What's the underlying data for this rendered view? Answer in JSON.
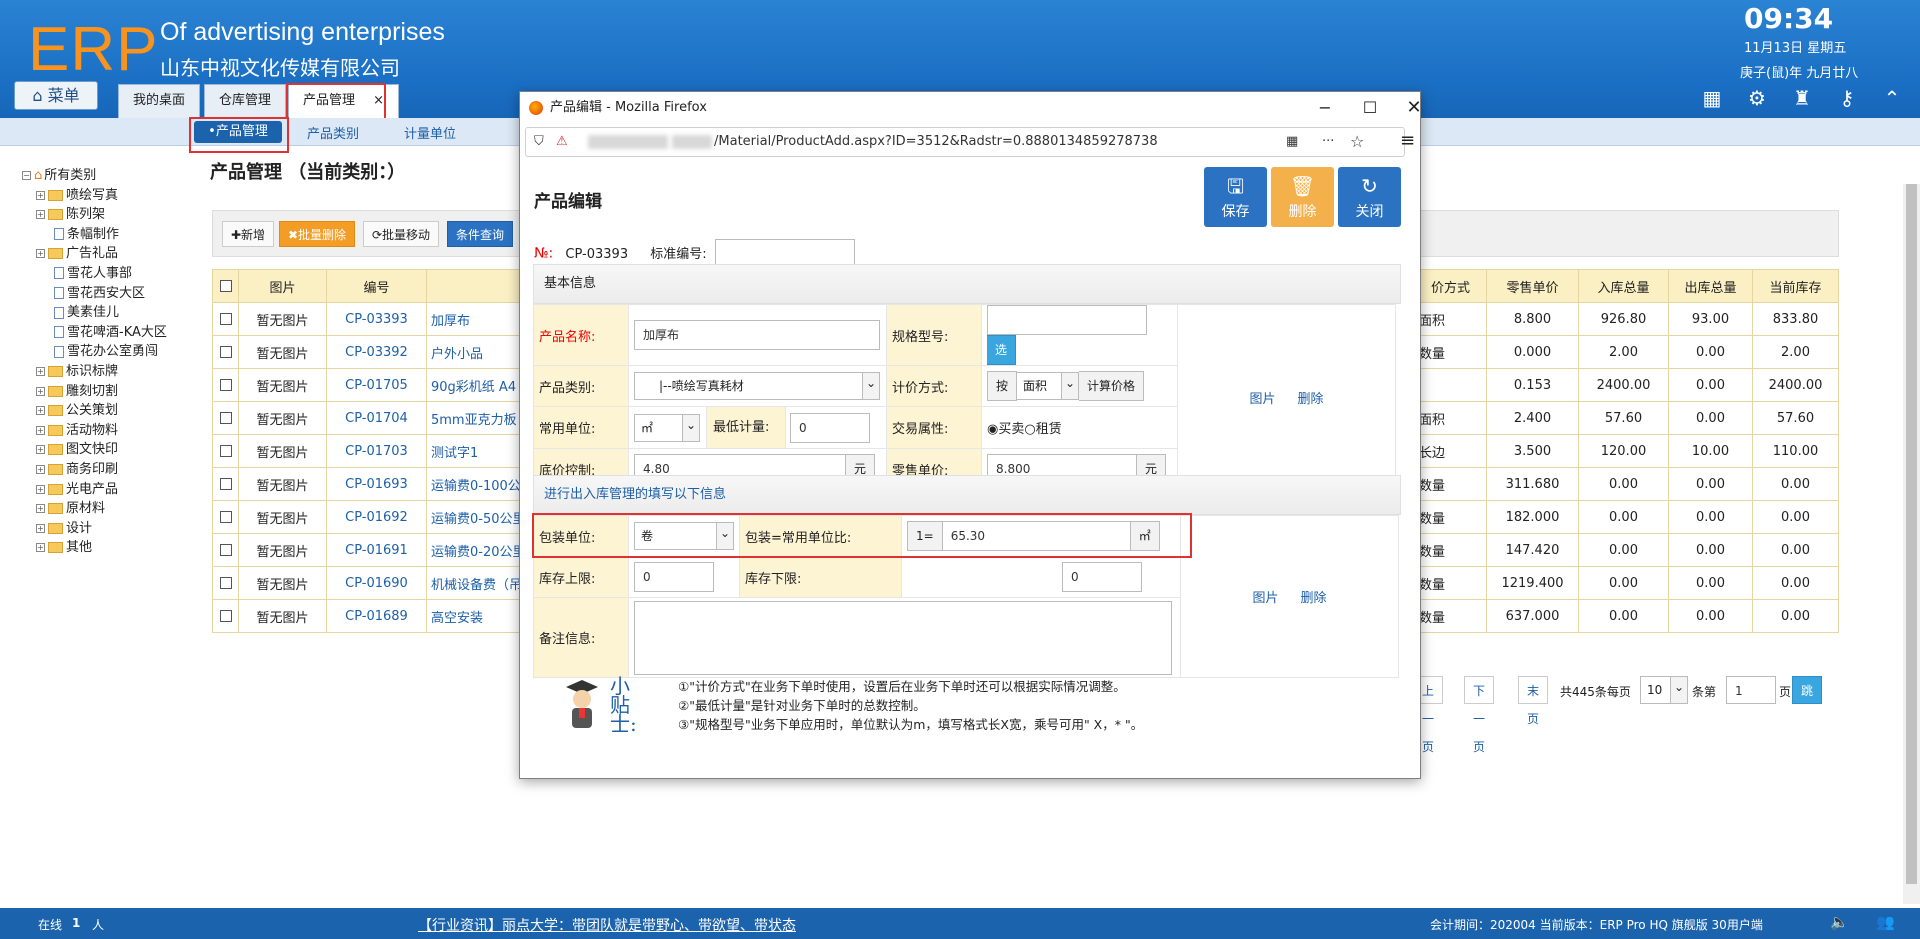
{
  "header": {
    "logo": "ERP",
    "brand_en": "Of advertising enterprises",
    "brand_cn": "山东中视文化传媒有限公司",
    "time": "09:34",
    "date": "11月13日 星期五",
    "lunar": "庚子(鼠)年 九月廿八",
    "menu_label": "菜单"
  },
  "tabs": [
    {
      "label": "我的桌面"
    },
    {
      "label": "仓库管理"
    },
    {
      "label": "产品管理",
      "close": "×"
    }
  ],
  "subnav": {
    "items": [
      "•产品管理",
      "产品类别",
      "计量单位"
    ]
  },
  "tree": {
    "root": "所有类别",
    "items": [
      {
        "label": "喷绘写真",
        "type": "folder"
      },
      {
        "label": "陈列架",
        "type": "folder"
      },
      {
        "label": "条幅制作",
        "type": "doc"
      },
      {
        "label": "广告礼品",
        "type": "folder"
      },
      {
        "label": "雪花人事部",
        "type": "doc"
      },
      {
        "label": "雪花西安大区",
        "type": "doc"
      },
      {
        "label": "美素佳儿",
        "type": "doc"
      },
      {
        "label": "雪花啤酒-KA大区",
        "type": "doc"
      },
      {
        "label": "雪花办公室勇闯",
        "type": "doc"
      },
      {
        "label": "标识标牌",
        "type": "folder"
      },
      {
        "label": "雕刻切割",
        "type": "folder"
      },
      {
        "label": "公关策划",
        "type": "folder"
      },
      {
        "label": "活动物料",
        "type": "folder"
      },
      {
        "label": "图文快印",
        "type": "folder"
      },
      {
        "label": "商务印刷",
        "type": "folder"
      },
      {
        "label": "光电产品",
        "type": "folder"
      },
      {
        "label": "原材料",
        "type": "folder"
      },
      {
        "label": "设计",
        "type": "folder"
      },
      {
        "label": "其他",
        "type": "folder"
      }
    ]
  },
  "page": {
    "title": "产品管理 （当前类别：）"
  },
  "toolbar": {
    "add": "✚新增",
    "batch_delete": "✖批量删除",
    "batch_move": "⟳批量移动",
    "query": "条件查询"
  },
  "grid": {
    "headers": [
      "图片",
      "编号",
      ""
    ],
    "right_headers": [
      "价方式",
      "零售单价",
      "入库总量",
      "出库总量",
      "当前库存"
    ],
    "rows": [
      {
        "img": "暂无图片",
        "code": "CP-03393",
        "name": "加厚布",
        "r": [
          "面积",
          "8.800",
          "926.80",
          "93.00",
          "833.80"
        ]
      },
      {
        "img": "暂无图片",
        "code": "CP-03392",
        "name": "户外小品",
        "r": [
          "数量",
          "0.000",
          "2.00",
          "0.00",
          "2.00"
        ]
      },
      {
        "img": "暂无图片",
        "code": "CP-01705",
        "name": "90g彩机纸 A4",
        "r": [
          "",
          "0.153",
          "2400.00",
          "0.00",
          "2400.00"
        ]
      },
      {
        "img": "暂无图片",
        "code": "CP-01704",
        "name": "5mm亚克力板",
        "r": [
          "面积",
          "2.400",
          "57.60",
          "0.00",
          "57.60"
        ]
      },
      {
        "img": "暂无图片",
        "code": "CP-01703",
        "name": "测试字1",
        "r": [
          "长边",
          "3.500",
          "120.00",
          "10.00",
          "110.00"
        ]
      },
      {
        "img": "暂无图片",
        "code": "CP-01693",
        "name": "运输费0-100公",
        "r": [
          "数量",
          "311.680",
          "0.00",
          "0.00",
          "0.00"
        ]
      },
      {
        "img": "暂无图片",
        "code": "CP-01692",
        "name": "运输费0-50公里",
        "r": [
          "数量",
          "182.000",
          "0.00",
          "0.00",
          "0.00"
        ]
      },
      {
        "img": "暂无图片",
        "code": "CP-01691",
        "name": "运输费0-20公里",
        "r": [
          "数量",
          "147.420",
          "0.00",
          "0.00",
          "0.00"
        ]
      },
      {
        "img": "暂无图片",
        "code": "CP-01690",
        "name": "机械设备费（吊",
        "r": [
          "数量",
          "1219.400",
          "0.00",
          "0.00",
          "0.00"
        ]
      },
      {
        "img": "暂无图片",
        "code": "CP-01689",
        "name": "高空安装",
        "r": [
          "数量",
          "637.000",
          "0.00",
          "0.00",
          "0.00"
        ]
      }
    ]
  },
  "pager": {
    "prev": "上一页",
    "next": "下一页",
    "last": "末页",
    "total": "共445条每页",
    "per_page": "10",
    "unit": "条第",
    "page": "1",
    "page_unit": "页",
    "go": "跳转"
  },
  "status": {
    "online_label": "在线",
    "online_count": "1",
    "online_unit": "人",
    "news": "【行业资讯】丽点大学：带团队就是带野心、带欲望、带状态",
    "version": "会计期间：202004 当前版本：ERP Pro HQ 旗舰版 30用户端"
  },
  "dialog": {
    "window_title": "产品编辑 - Mozilla Firefox",
    "url": "/Material/ProductAdd.aspx?ID=3512&Radstr=0.8880134859278738",
    "heading": "产品编辑",
    "save": "保存",
    "delete": "删除",
    "close": "关闭",
    "no_label": "№:",
    "no_value": "CP-03393",
    "std_code_label": "标准编号:",
    "std_code_value": "",
    "basic_section": "基本信息",
    "name_label": "产品名称:",
    "name_value": "加厚布",
    "spec_label": "规格型号:",
    "spec_value": "",
    "spec_btn": "选",
    "cat_label": "产品类别:",
    "cat_value": "|--喷绘写真耗材",
    "pricing_label": "计价方式:",
    "pricing_prefix": "按",
    "pricing_value": "面积",
    "pricing_btn": "计算价格",
    "unit_label": "常用单位:",
    "unit_value": "㎡",
    "min_label": "最低计量:",
    "min_value": "0",
    "trade_label": "交易属性:",
    "trade_opt1": "买卖",
    "trade_opt2": "租赁",
    "floor_label": "底价控制:",
    "floor_value": "4.80",
    "floor_unit": "元",
    "retail_label": "零售单价:",
    "retail_value": "8.800",
    "retail_unit": "元",
    "pic_link": "图片",
    "del_link": "删除",
    "stock_section": "进行出入库管理的填写以下信息",
    "pack_label": "包装单位:",
    "pack_value": "卷",
    "ratio_label": "包装=常用单位比:",
    "ratio_prefix": "1=",
    "ratio_value": "65.30",
    "ratio_unit": "㎡",
    "max_label": "库存上限:",
    "max_value": "0",
    "minstock_label": "库存下限:",
    "minstock_value": "0",
    "note_label": "备注信息:",
    "note_value": "",
    "tip_title": "小贴士:",
    "tips": [
      "①\"计价方式\"在业务下单时使用，设置后在业务下单时还可以根据实际情况调整。",
      "②\"最低计量\"是针对业务下单时的总数控制。",
      "③\"规格型号\"业务下单应用时，单位默认为m，填写格式长X宽，乘号可用\" X，* \"。"
    ]
  }
}
